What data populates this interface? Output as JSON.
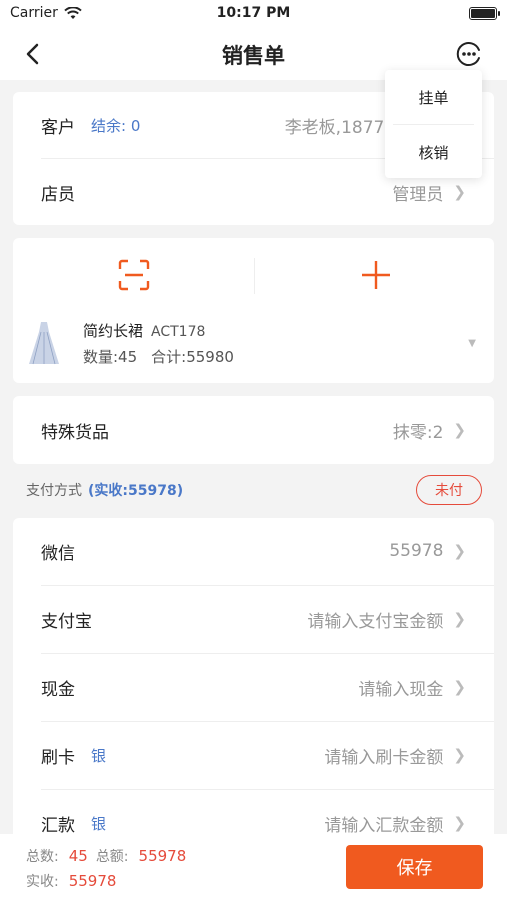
{
  "status_bar": {
    "carrier": "Carrier",
    "time": "10:17 PM"
  },
  "navbar": {
    "title": "销售单"
  },
  "menu": {
    "items": [
      "挂单",
      "核销"
    ]
  },
  "customer_card": {
    "customer_label": "客户",
    "balance_tag": "结余: 0",
    "customer_value": "李老板,187774",
    "clerk_label": "店员",
    "clerk_value": "管理员"
  },
  "goods": {
    "name": "简约长裙",
    "code": "ACT178",
    "quantity": "数量:45",
    "total": "合计:55980"
  },
  "special": {
    "label": "特殊货品",
    "value": "抹零:2"
  },
  "payment": {
    "header_label": "支付方式",
    "actual": "(实收:55978)",
    "status": "未付",
    "methods": [
      {
        "label": "微信",
        "tag": "",
        "value": "55978"
      },
      {
        "label": "支付宝",
        "tag": "",
        "value": "请输入支付宝金额"
      },
      {
        "label": "现金",
        "tag": "",
        "value": "请输入现金"
      },
      {
        "label": "刷卡",
        "tag": "银",
        "value": "请输入刷卡金额"
      },
      {
        "label": "汇款",
        "tag": "银",
        "value": "请输入汇款金额"
      }
    ]
  },
  "footer": {
    "count_label": "总数:",
    "count_value": "45",
    "amount_label": "总额:",
    "amount_value": "55978",
    "received_label": "实收:",
    "received_value": "55978",
    "save_label": "保存"
  },
  "colors": {
    "accent": "#f05a1f",
    "link": "#4a78c8",
    "danger": "#e54b3b"
  },
  "icons": {
    "back": "chevron-left-icon",
    "more": "more-circle-icon",
    "scan": "scan-icon",
    "add": "plus-icon",
    "row": "chevron-right-icon"
  }
}
